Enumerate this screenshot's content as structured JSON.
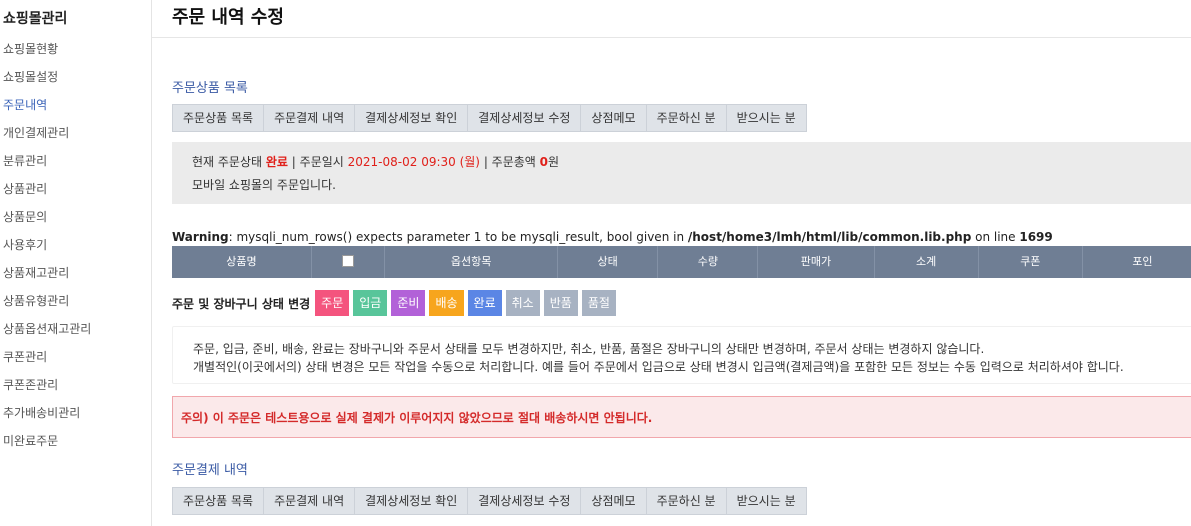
{
  "sidebar": {
    "title": "쇼핑몰관리",
    "items": [
      {
        "label": "쇼핑몰현황"
      },
      {
        "label": "쇼핑몰설정"
      },
      {
        "label": "주문내역",
        "active": true
      },
      {
        "label": "개인결제관리"
      },
      {
        "label": "분류관리"
      },
      {
        "label": "상품관리"
      },
      {
        "label": "상품문의"
      },
      {
        "label": "사용후기"
      },
      {
        "label": "상품재고관리"
      },
      {
        "label": "상품유형관리"
      },
      {
        "label": "상품옵션재고관리"
      },
      {
        "label": "쿠폰관리"
      },
      {
        "label": "쿠폰존관리"
      },
      {
        "label": "추가배송비관리"
      },
      {
        "label": "미완료주문"
      }
    ]
  },
  "page": {
    "title": "주문 내역 수정"
  },
  "section1": {
    "title": "주문상품 목록",
    "tabs": [
      "주문상품 목록",
      "주문결제 내역",
      "결제상세정보 확인",
      "결제상세정보 수정",
      "상점메모",
      "주문하신 분",
      "받으시는 분"
    ]
  },
  "status": {
    "prefix": "현재 주문상태",
    "state": "완료",
    "sep1": " | 주문일시 ",
    "datetime": "2021-08-02 09:30 (월)",
    "sep2": " | 주문총액 ",
    "total": "0",
    "unit": "원",
    "line2": "모바일 쇼핑몰의 주문입니다."
  },
  "warning": {
    "label": "Warning",
    "message": ": mysqli_num_rows() expects parameter 1 to be mysqli_result, bool given in ",
    "path": "/host/home3/lmh/html/lib/common.lib.php",
    "on_line": " on line ",
    "line": "1699"
  },
  "grid": {
    "columns": [
      "상품명",
      "",
      "옵션항목",
      "상태",
      "수량",
      "판매가",
      "소계",
      "쿠폰",
      "포인"
    ]
  },
  "status_change": {
    "label": "주문 및 장바구니 상태 변경",
    "buttons": [
      {
        "label": "주문",
        "color": "#f4547e"
      },
      {
        "label": "입금",
        "color": "#58c59a"
      },
      {
        "label": "준비",
        "color": "#b261d8"
      },
      {
        "label": "배송",
        "color": "#f7a51d"
      },
      {
        "label": "완료",
        "color": "#5b86e5"
      },
      {
        "label": "취소",
        "color": "#a7b2c2"
      },
      {
        "label": "반품",
        "color": "#a7b2c2"
      },
      {
        "label": "품절",
        "color": "#a7b2c2"
      }
    ]
  },
  "info": {
    "line1": "주문, 입금, 준비, 배송, 완료는 장바구니와 주문서 상태를 모두 변경하지만, 취소, 반품, 품절은 장바구니의 상태만 변경하며, 주문서 상태는 변경하지 않습니다.",
    "line2": "개별적인(이곳에서의) 상태 변경은 모든 작업을 수동으로 처리합니다. 예를 들어 주문에서 입금으로 상태 변경시 입금액(결제금액)을 포함한 모든 정보는 수동 입력으로 처리하셔야 합니다."
  },
  "alert": {
    "text": "주의) 이 주문은 테스트용으로 실제 결제가 이루어지지 않았으므로 절대 배송하시면 안됩니다."
  },
  "section2": {
    "title": "주문결제 내역",
    "tabs": [
      "주문상품 목록",
      "주문결제 내역",
      "결제상세정보 확인",
      "결제상세정보 수정",
      "상점메모",
      "주문하신 분",
      "받으시는 분"
    ]
  }
}
